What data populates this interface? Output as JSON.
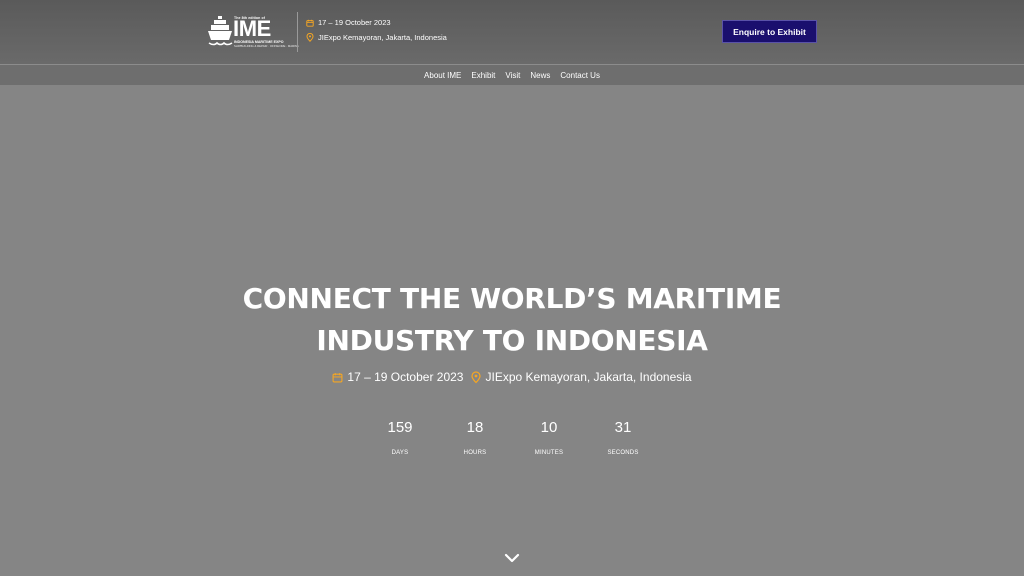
{
  "header": {
    "logo": {
      "edition": "The 8th edition of",
      "name": "IME",
      "subtitle": "INDONESIA MARITIME EXPO",
      "tagline": "SHIPBUILDING & REPAIR · OFFSHORE · MARINE"
    },
    "date": "17 – 19 October 2023",
    "venue": "JIExpo Kemayoran, Jakarta, Indonesia",
    "cta_label": "Enquire to Exhibit"
  },
  "nav": {
    "items": [
      {
        "label": "About IME"
      },
      {
        "label": "Exhibit"
      },
      {
        "label": "Visit"
      },
      {
        "label": "News"
      },
      {
        "label": "Contact Us"
      }
    ]
  },
  "hero": {
    "title_line1": "CONNECT THE WORLD’S MARITIME",
    "title_line2": "INDUSTRY TO INDONESIA",
    "date": "17 – 19 October 2023",
    "venue": "JIExpo Kemayoran, Jakarta, Indonesia",
    "countdown": [
      {
        "value": "159",
        "label": "DAYS"
      },
      {
        "value": "18",
        "label": "HOURS"
      },
      {
        "value": "10",
        "label": "MINUTES"
      },
      {
        "value": "31",
        "label": "SECONDS"
      }
    ]
  },
  "icons": {
    "calendar": "calendar-icon",
    "location": "location-pin-icon",
    "scroll": "chevron-down-icon",
    "logo": "ship-icon"
  },
  "colors": {
    "accent": "#f5a623",
    "cta_bg": "#1a0f6e",
    "background": "#858585"
  }
}
